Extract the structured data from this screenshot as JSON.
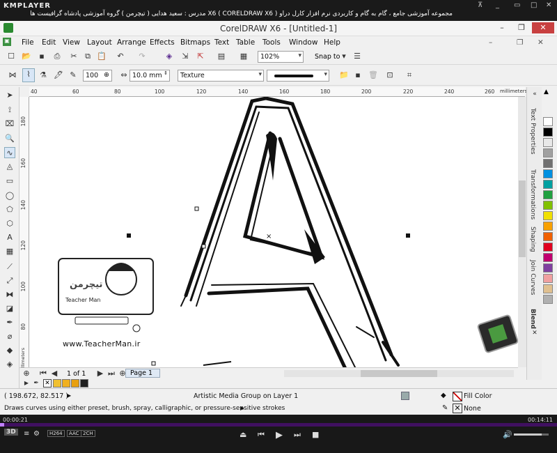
{
  "player": {
    "logo": "KMPLAYER",
    "title": "مجموعه آموزشی جامع ، گام به گام و کاربردی نرم افزار کارل دراو X6 ( CORELDRAW X6 )   مدرس : سعید هدایی ( تیچرمن ) گروه آموزشی پادشاه گرافیست ها",
    "elapsed": "00:00:21",
    "total": "00:14:11",
    "progress_fraction": 0.008,
    "badges": [
      "3D",
      "H264",
      "AAC",
      "2CH"
    ]
  },
  "app": {
    "title": "CorelDRAW X6 - [Untitled-1]",
    "menu": [
      "File",
      "Edit",
      "View",
      "Layout",
      "Arrange",
      "Effects",
      "Bitmaps",
      "Text",
      "Table",
      "Tools",
      "Window",
      "Help"
    ],
    "zoom": "102%",
    "snap_to": "Snap to"
  },
  "propertybar": {
    "value_100": "100",
    "width": "10.0 mm",
    "texture": "Texture"
  },
  "rulers": {
    "unit": "millimeters",
    "h_ticks": [
      "40",
      "60",
      "80",
      "100",
      "120",
      "140",
      "160",
      "180",
      "200",
      "220",
      "240",
      "260"
    ],
    "v_ticks": [
      "180",
      "160",
      "140",
      "120",
      "100",
      "80"
    ]
  },
  "watermark": {
    "brand_fa": "تیچرمن",
    "brand_en": "Teacher Man",
    "url": "www.TeacherMan.ir"
  },
  "pagebar": {
    "count": "1 of 1",
    "tab": "Page 1"
  },
  "dockers": [
    "Text Properties",
    "Transformations",
    "Shaping",
    "Join Curves",
    "Blend"
  ],
  "palette": [
    "#ffffff",
    "#000000",
    "#e8e8e8",
    "#a0a0a0",
    "#707070",
    "#0090e0",
    "#00a0a0",
    "#20a040",
    "#80c000",
    "#f0e000",
    "#f8a000",
    "#f06000",
    "#e00020",
    "#c00070",
    "#8040a0",
    "#f0a0a0",
    "#e0c090",
    "#b0b0b0"
  ],
  "docpal": [
    "#f0c030",
    "#f0b020",
    "#e8a010",
    "#202020"
  ],
  "status": {
    "coords": "( 198.672, 82.517 )",
    "object": "Artistic Media Group on Layer 1",
    "hint": "Draws curves using either preset, brush, spray, calligraphic, or pressure-sensitive strokes",
    "fill": "Fill Color",
    "outline": "None"
  }
}
